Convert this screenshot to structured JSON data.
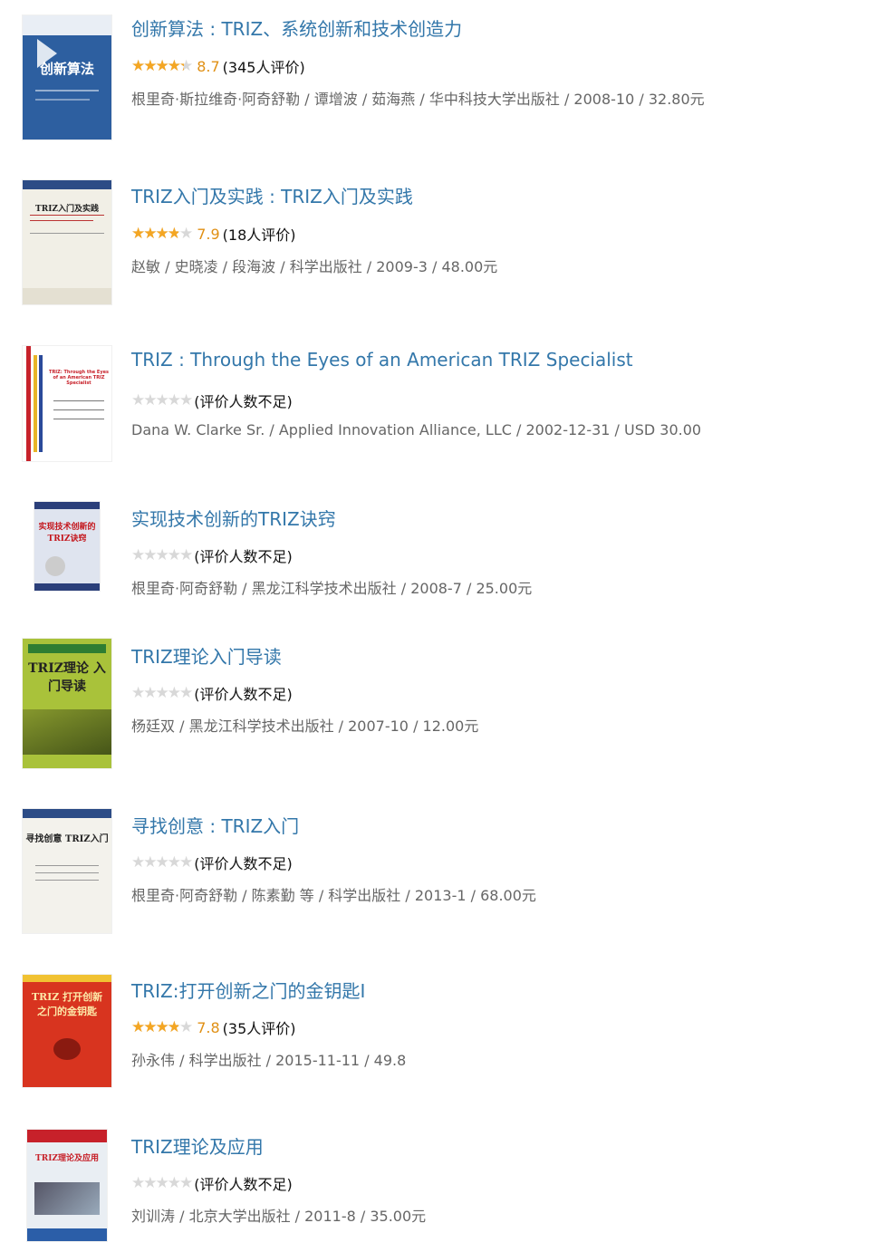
{
  "books": [
    {
      "title": "创新算法 : TRIZ、系统创新和技术创造力",
      "rating": 8.7,
      "score": "8.7",
      "count": "(345人评价)",
      "pub": "根里奇·斯拉维奇·阿奇舒勒 / 谭增波 / 茹海燕 / 华中科技大学出版社 / 2008-10 / 32.80元",
      "cover_text": "创新算法",
      "cover_color": "#2d5fa0"
    },
    {
      "title": "TRIZ入门及实践 : TRIZ入门及实践",
      "rating": 7.9,
      "score": "7.9",
      "count": "(18人评价)",
      "pub": "赵敏 / 史晓凌 / 段海波 / 科学出版社 / 2009-3 / 48.00元",
      "cover_text": "TRIZ入门及实践",
      "cover_color": "#f1efe6"
    },
    {
      "title": "TRIZ : Through the Eyes of an American TRIZ Specialist",
      "rating": 0,
      "score": "",
      "count": "(评价人数不足)",
      "pub": "Dana W. Clarke Sr. / Applied Innovation Alliance, LLC / 2002-12-31 / USD 30.00",
      "cover_text": "TRIZ: Through the Eyes of an American TRIZ Specialist",
      "cover_color": "#ffffff"
    },
    {
      "title": "实现技术创新的TRIZ诀窍",
      "rating": 0,
      "score": "",
      "count": "(评价人数不足)",
      "pub": "根里奇·阿奇舒勒 / 黑龙江科学技术出版社 / 2008-7 / 25.00元",
      "cover_text": "实现技术创新的TRIZ诀窍",
      "cover_color": "#dfe4ef"
    },
    {
      "title": "TRIZ理论入门导读",
      "rating": 0,
      "score": "",
      "count": "(评价人数不足)",
      "pub": "杨廷双 / 黑龙江科学技术出版社 / 2007-10 / 12.00元",
      "cover_text": "TRIZ理论 入门导读",
      "cover_color": "#a9c23a"
    },
    {
      "title": "寻找创意 : TRIZ入门",
      "rating": 0,
      "score": "",
      "count": "(评价人数不足)",
      "pub": "根里奇·阿奇舒勒 / 陈素勤 等 / 科学出版社 / 2013-1 / 68.00元",
      "cover_text": "寻找创意 TRIZ入门",
      "cover_color": "#f3f2ec"
    },
    {
      "title": "TRIZ:打开创新之门的金钥匙I",
      "rating": 7.8,
      "score": "7.8",
      "count": "(35人评价)",
      "pub": "孙永伟 / 科学出版社 / 2015-11-11 / 49.8",
      "cover_text": "TRIZ 打开创新之门的金钥匙",
      "cover_color": "#d8341f"
    },
    {
      "title": "TRIZ理论及应用",
      "rating": 0,
      "score": "",
      "count": "(评价人数不足)",
      "pub": "刘训涛 / 北京大学出版社 / 2011-8 / 35.00元",
      "cover_text": "TRIZ理论及应用",
      "cover_color": "#e9eef3"
    }
  ]
}
